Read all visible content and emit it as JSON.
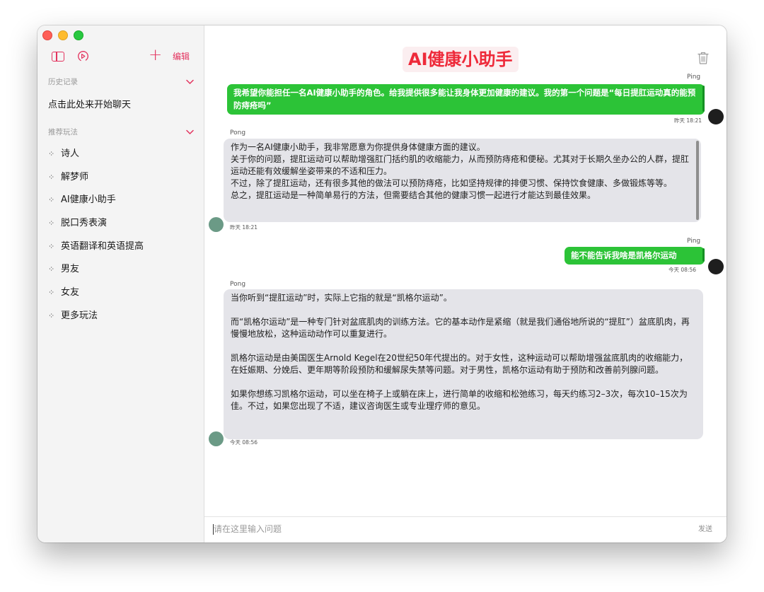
{
  "sidebar": {
    "edit_label": "编辑",
    "history_header": "历史记录",
    "history_items": [
      "点击此处来开始聊天"
    ],
    "recommend_header": "推荐玩法",
    "recommend_items": [
      "诗人",
      "解梦师",
      "AI健康小助手",
      "脱口秀表演",
      "英语翻译和英语提高",
      "男友",
      "女友",
      "更多玩法"
    ]
  },
  "main": {
    "title": "AI健康小助手",
    "messages": [
      {
        "role": "user",
        "sender": "Ping",
        "text": "我希望你能担任一名AI健康小助手的角色。给我提供很多能让我身体更加健康的建议。我的第一个问题是“每日提肛运动真的能预防痔疮吗”",
        "time": "昨天 18:21"
      },
      {
        "role": "assistant",
        "sender": "Pong",
        "paragraphs": [
          "作为一名AI健康小助手，我非常愿意为你提供身体健康方面的建议。",
          "关于你的问题，提肛运动可以帮助增强肛门括约肌的收缩能力，从而预防痔疮和便秘。尤其对于长期久坐办公的人群，提肛运动还能有效缓解坐姿带来的不适和压力。",
          "不过，除了提肛运动，还有很多其他的做法可以预防痔疮，比如坚持规律的排便习惯、保持饮食健康、多做锻炼等等。",
          "总之，提肛运动是一种简单易行的方法，但需要结合其他的健康习惯一起进行才能达到最佳效果。"
        ],
        "time": "昨天 18:21"
      },
      {
        "role": "user",
        "sender": "Ping",
        "text": "能不能告诉我啥是凯格尔运动",
        "time": "今天 08:56"
      },
      {
        "role": "assistant",
        "sender": "Pong",
        "paragraphs": [
          "当你听到“提肛运动”时，实际上它指的就是“凯格尔运动”。",
          "",
          "而“凯格尔运动”是一种专门针对盆底肌肉的训练方法。它的基本动作是紧缩（就是我们通俗地所说的“提肛”）盆底肌肉，再慢慢地放松，这种运动动作可以重复进行。",
          "",
          "凯格尔运动是由美国医生Arnold Kegel在20世纪50年代提出的。对于女性，这种运动可以帮助增强盆底肌肉的收缩能力，在妊娠期、分娩后、更年期等阶段预防和缓解尿失禁等问题。对于男性，凯格尔运动有助于预防和改善前列腺问题。",
          "",
          "如果你想练习凯格尔运动，可以坐在椅子上或躺在床上，进行简单的收缩和松弛练习，每天约练习2–3次，每次10–15次为佳。不过，如果您出现了不适，建议咨询医生或专业理疗师的意见。"
        ],
        "time": "今天 08:56"
      }
    ]
  },
  "input": {
    "placeholder": "请在这里输入问题",
    "send_label": "发送"
  },
  "colors": {
    "accent": "#e3345f",
    "title_red": "#ee2a3a",
    "user_bubble": "#2cc337",
    "assistant_bubble": "#e4e4e9"
  },
  "icons": [
    "sidebar-toggle-icon",
    "gauge-icon",
    "plus-icon",
    "chevron-down-icon",
    "sparkle-icon",
    "trash-icon"
  ]
}
